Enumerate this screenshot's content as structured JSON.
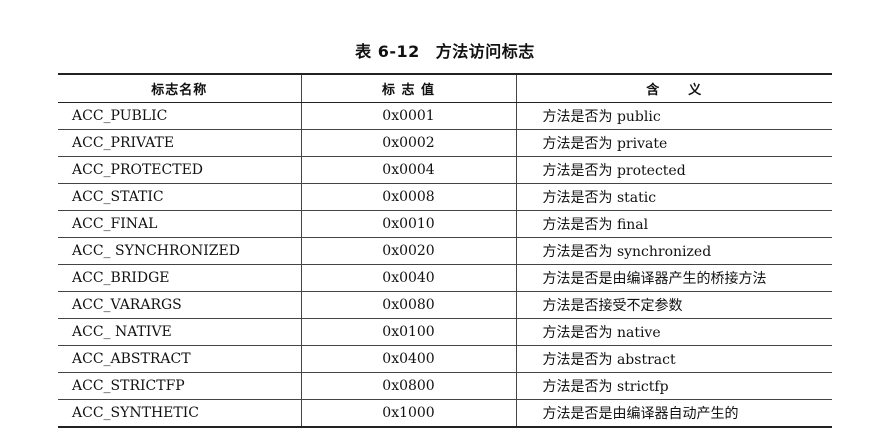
{
  "caption": {
    "number": "表 6-12",
    "title": "方法访问标志"
  },
  "table": {
    "headers": [
      "标志名称",
      "标 志 值",
      "含　　义"
    ],
    "rows": [
      {
        "name": "ACC_PUBLIC",
        "value": "0x0001",
        "meaning": "方法是否为 public"
      },
      {
        "name": "ACC_PRIVATE",
        "value": "0x0002",
        "meaning": "方法是否为 private"
      },
      {
        "name": "ACC_PROTECTED",
        "value": "0x0004",
        "meaning": "方法是否为 protected"
      },
      {
        "name": "ACC_STATIC",
        "value": "0x0008",
        "meaning": "方法是否为 static"
      },
      {
        "name": "ACC_FINAL",
        "value": "0x0010",
        "meaning": "方法是否为 final"
      },
      {
        "name": "ACC_ SYNCHRONIZED",
        "value": "0x0020",
        "meaning": "方法是否为 synchronized"
      },
      {
        "name": "ACC_BRIDGE",
        "value": "0x0040",
        "meaning": "方法是否是由编译器产生的桥接方法"
      },
      {
        "name": "ACC_VARARGS",
        "value": "0x0080",
        "meaning": "方法是否接受不定参数"
      },
      {
        "name": "ACC_ NATIVE",
        "value": "0x0100",
        "meaning": "方法是否为 native"
      },
      {
        "name": "ACC_ABSTRACT",
        "value": "0x0400",
        "meaning": "方法是否为 abstract"
      },
      {
        "name": "ACC_STRICTFP",
        "value": "0x0800",
        "meaning": "方法是否为 strictfp"
      },
      {
        "name": "ACC_SYNTHETIC",
        "value": "0x1000",
        "meaning": "方法是否是由编译器自动产生的"
      }
    ]
  }
}
